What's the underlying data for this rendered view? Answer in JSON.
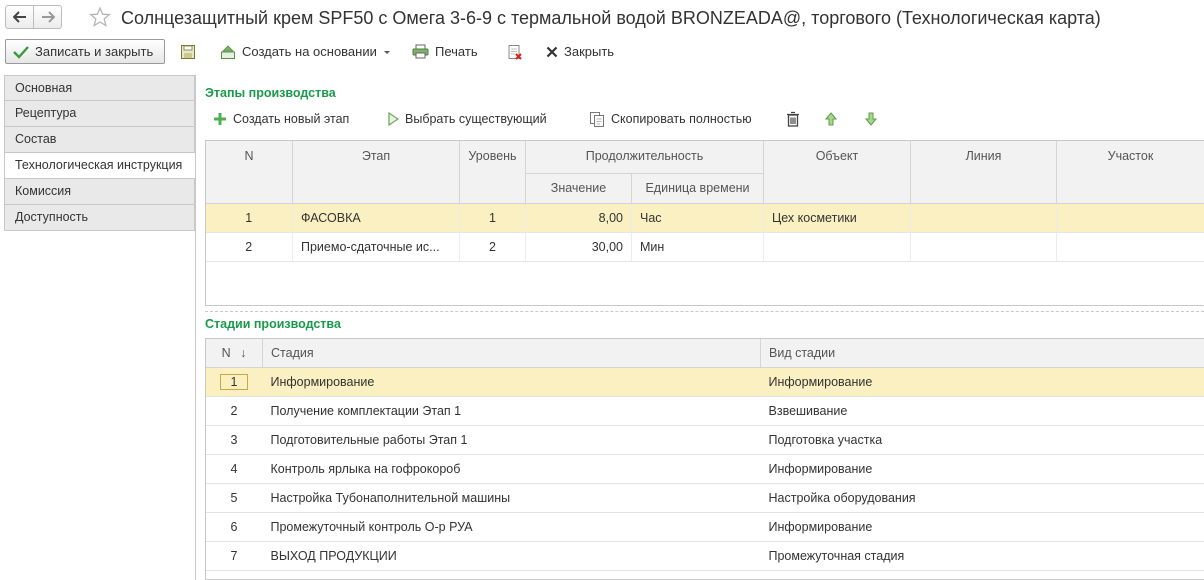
{
  "window": {
    "title": "Солнцезащитный крем SPF50 с Омега 3-6-9 с термальной водой BRONZEADA@, торгового (Технологическая карта)"
  },
  "toolbar": {
    "save_close_label": "Записать и закрыть",
    "create_based_label": "Создать на основании",
    "print_label": "Печать",
    "close_label": "Закрыть"
  },
  "sidebar": {
    "items": [
      {
        "label": "Основная"
      },
      {
        "label": "Рецептура"
      },
      {
        "label": "Состав"
      },
      {
        "label": "Технологическая инструкция"
      },
      {
        "label": "Комиссия"
      },
      {
        "label": "Доступность"
      }
    ],
    "active_index": 3
  },
  "stages": {
    "title": "Этапы производства",
    "toolbar": {
      "create_new": "Создать новый этап",
      "select_existing": "Выбрать существующий",
      "copy_full": "Скопировать полностью"
    },
    "columns": {
      "n": "N",
      "stage": "Этап",
      "level": "Уровень",
      "duration": "Продолжительность",
      "value": "Значение",
      "unit": "Единица времени",
      "object": "Объект",
      "line": "Линия",
      "section": "Участок"
    },
    "rows": [
      {
        "n": "1",
        "stage": "ФАСОВКА",
        "level": "1",
        "value": "8,00",
        "unit": "Час",
        "object": "Цех косметики",
        "line": "",
        "section": ""
      },
      {
        "n": "2",
        "stage": "Приемо-сдаточные ис...",
        "level": "2",
        "value": "30,00",
        "unit": "Мин",
        "object": "",
        "line": "",
        "section": ""
      }
    ],
    "selected_row": 0
  },
  "phases": {
    "title": "Стадии производства",
    "columns": {
      "n": "N",
      "sort_indicator": "↓",
      "phase": "Стадия",
      "kind": "Вид стадии"
    },
    "rows": [
      {
        "n": "1",
        "phase": "Информирование",
        "kind": "Информирование"
      },
      {
        "n": "2",
        "phase": "Получение комплектации Этап 1",
        "kind": "Взвешивание"
      },
      {
        "n": "3",
        "phase": "Подготовительные работы Этап 1",
        "kind": "Подготовка участка"
      },
      {
        "n": "4",
        "phase": "Контроль ярлыка на гофрокороб",
        "kind": "Информирование"
      },
      {
        "n": "5",
        "phase": "Настройка Тубонаполнительной машины",
        "kind": "Настройка оборудования"
      },
      {
        "n": "6",
        "phase": "Промежуточный контроль О-р РУА",
        "kind": "Информирование"
      },
      {
        "n": "7",
        "phase": "ВЫХОД ПРОДУКЦИИ",
        "kind": "Промежуточная стадия"
      }
    ],
    "selected_row": 0
  },
  "colors": {
    "accent_green": "#1a9a4a",
    "selection": "#fbf0c2",
    "icon_green": "#4caf50"
  }
}
